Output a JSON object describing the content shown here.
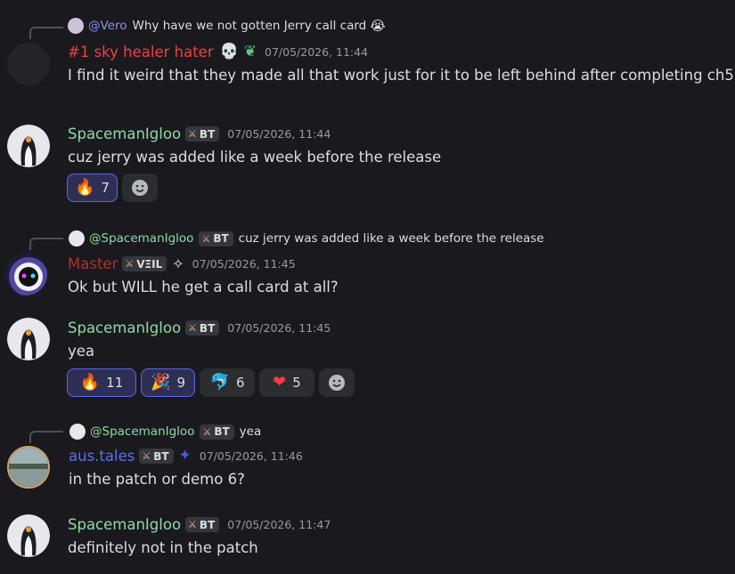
{
  "messages": [
    {
      "reply": {
        "name": "@Vero",
        "text": "Why have we not gotten Jerry call card",
        "emoji": "😭"
      },
      "author": "#1 sky healer hater",
      "author_color": "#f23f43",
      "badges": [
        "💀",
        "❦"
      ],
      "timestamp": "07/05/2026, 11:44",
      "text": "I find it weird that they made all that work just for it to be left behind after completing ch5"
    },
    {
      "author": "SpacemanIgloo",
      "author_color": "#8fd9a8",
      "tag": "BT",
      "timestamp": "07/05/2026, 11:44",
      "text": "cuz jerry was added like a week before the release",
      "reactions": [
        {
          "emoji": "🔥",
          "count": "7",
          "active": true
        }
      ]
    },
    {
      "reply": {
        "name": "@SpacemanIgloo",
        "tag": "BT",
        "text": "cuz jerry was added like a week before the release"
      },
      "author": "Master",
      "author_color": "#b52f2f",
      "tag": "VΞIL",
      "timestamp": "07/05/2026, 11:45",
      "text": "Ok but WILL he get a call card at all?"
    },
    {
      "author": "SpacemanIgloo",
      "author_color": "#8fd9a8",
      "tag": "BT",
      "timestamp": "07/05/2026, 11:45",
      "text": "yea",
      "reactions": [
        {
          "emoji": "🔥",
          "count": "11",
          "active": true
        },
        {
          "emoji": "🎉",
          "count": "9",
          "active": true
        },
        {
          "emoji": "🐬",
          "count": "6",
          "active": false
        },
        {
          "emoji": "❤",
          "count": "5",
          "active": false
        }
      ]
    },
    {
      "reply": {
        "name": "@SpacemanIgloo",
        "tag": "BT",
        "text": "yea"
      },
      "author": "aus.tales",
      "author_color": "#5b6ef5",
      "tag": "BT",
      "timestamp": "07/05/2026, 11:46",
      "text": "in the patch or demo 6?"
    },
    {
      "author": "SpacemanIgloo",
      "author_color": "#8fd9a8",
      "tag": "BT",
      "timestamp": "07/05/2026, 11:47",
      "text": "definitely not in the patch"
    }
  ],
  "icons": {
    "tag_icon": "sword-icon",
    "add_reaction": "smiley-icon"
  }
}
